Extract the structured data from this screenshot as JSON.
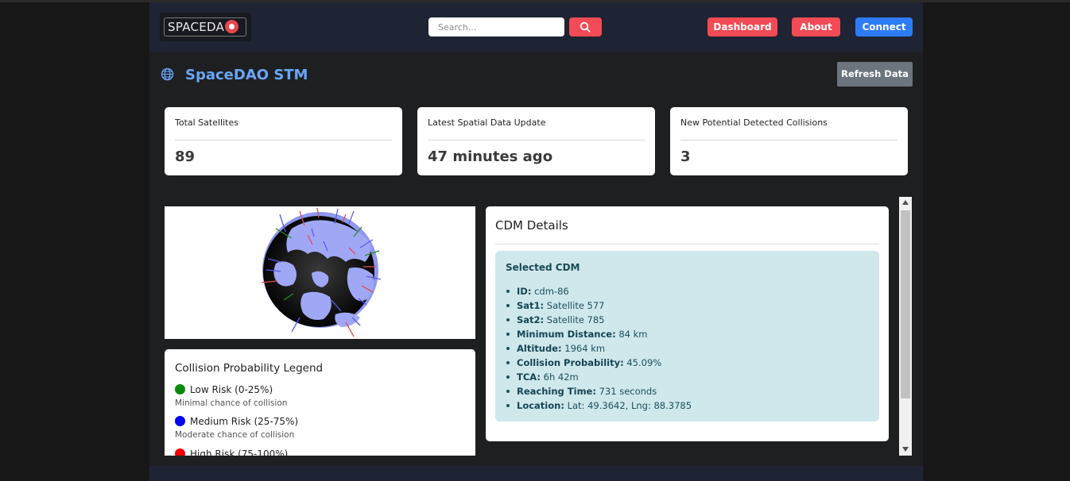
{
  "navbar": {
    "logo_text": "SPACEDA",
    "search_placeholder": "Search...",
    "buttons": {
      "dashboard": "Dashboard",
      "about": "About",
      "connect": "Connect"
    }
  },
  "page": {
    "title": "SpaceDAO STM",
    "refresh_label": "Refresh Data"
  },
  "stats": [
    {
      "label": "Total Satellites",
      "value": "89"
    },
    {
      "label": "Latest Spatial Data Update",
      "value": "47 minutes ago"
    },
    {
      "label": "New Potential Detected Collisions",
      "value": "3"
    }
  ],
  "legend": {
    "title": "Collision Probability Legend",
    "items": [
      {
        "name": "Low Risk (0-25%)",
        "desc": "Minimal chance of collision",
        "color": "#0a8a0a"
      },
      {
        "name": "Medium Risk (25-75%)",
        "desc": "Moderate chance of collision",
        "color": "#0000f0"
      },
      {
        "name": "High Risk (75-100%)",
        "desc": "",
        "color": "#f00000"
      }
    ]
  },
  "cdm": {
    "title": "CDM Details",
    "box_title": "Selected CDM",
    "fields": [
      {
        "label": "ID:",
        "value": "cdm-86"
      },
      {
        "label": "Sat1:",
        "value": "Satellite 577"
      },
      {
        "label": "Sat2:",
        "value": "Satellite 785"
      },
      {
        "label": "Minimum Distance:",
        "value": "84 km"
      },
      {
        "label": "Altitude:",
        "value": "1964 km"
      },
      {
        "label": "Collision Probability:",
        "value": "45.09%"
      },
      {
        "label": "TCA:",
        "value": "6h 42m"
      },
      {
        "label": "Reaching Time:",
        "value": "731 seconds"
      },
      {
        "label": "Location:",
        "value": "Lat: 49.3642, Lng: 88.3785"
      }
    ]
  },
  "colors": {
    "accent_red": "#f24b55",
    "accent_blue": "#2d7cf6",
    "title_blue": "#6aa6f7",
    "navbar_bg": "#1e2433"
  }
}
